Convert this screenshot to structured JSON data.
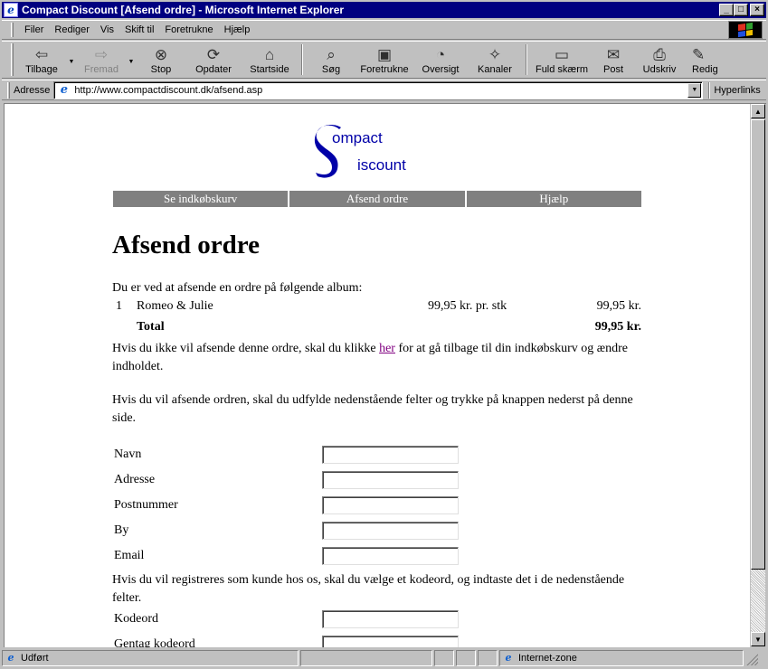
{
  "window": {
    "title": "Compact Discount [Afsend ordre] - Microsoft Internet Explorer",
    "controls": {
      "minimize": "_",
      "maximize": "□",
      "close": "×"
    }
  },
  "menu": [
    "Filer",
    "Rediger",
    "Vis",
    "Skift til",
    "Foretrukne",
    "Hjælp"
  ],
  "toolbar": {
    "back": "Tilbage",
    "forward": "Fremad",
    "stop": "Stop",
    "refresh": "Opdater",
    "home": "Startside",
    "search": "Søg",
    "favorites": "Foretrukne",
    "history": "Oversigt",
    "channels": "Kanaler",
    "fullscreen": "Fuld skærm",
    "mail": "Post",
    "print": "Udskriv",
    "edit": "Redig"
  },
  "address": {
    "label": "Adresse",
    "url": "http://www.compactdiscount.dk/afsend.asp",
    "links_label": "Hyperlinks"
  },
  "page": {
    "logo": {
      "letter": "S",
      "line1": "ompact",
      "line2": "iscount"
    },
    "nav": [
      "Se indkøbskurv",
      "Afsend ordre",
      "Hjælp"
    ],
    "heading": "Afsend ordre",
    "intro": "Du er ved at afsende en ordre på følgende album:",
    "order": {
      "qty": "1",
      "album": "Romeo & Julie",
      "unit_price": "99,95 kr. pr. stk",
      "line_total": "99,95 kr.",
      "total_label": "Total",
      "total_value": "99,95 kr."
    },
    "cancel_text_before": "Hvis du ikke vil afsende denne ordre, skal du klikke ",
    "cancel_link": "her",
    "cancel_text_after": " for at gå tilbage til din indkøbskurv og ændre indholdet.",
    "fill_text": "Hvis du vil afsende ordren, skal du udfylde nedenstående felter og trykke på knappen nederst på denne side.",
    "fields": {
      "name": "Navn",
      "address": "Adresse",
      "postal": "Postnummer",
      "city": "By",
      "email": "Email"
    },
    "register_text": "Hvis du vil registreres som kunde hos os, skal du vælge et kodeord, og indtaste det i de nedenstående felter.",
    "password_label": "Kodeord",
    "repeat_password_label": "Gentag kodeord"
  },
  "status": {
    "text": "Udført",
    "zone": "Internet-zone"
  }
}
